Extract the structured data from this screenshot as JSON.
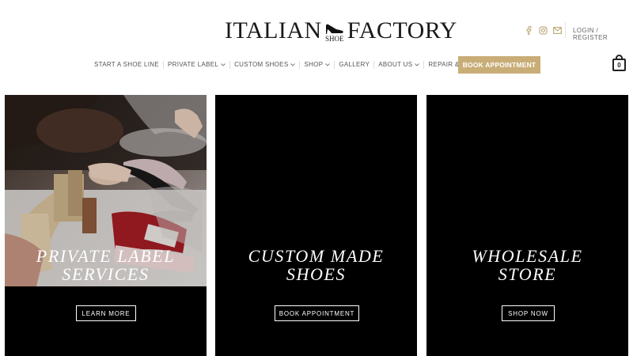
{
  "brand": {
    "word_left": "ITALIAN",
    "word_mid": "SHOE",
    "word_right": "FACTORY"
  },
  "header": {
    "social_icons": [
      "facebook-icon",
      "instagram-icon",
      "mail-icon"
    ],
    "login_label": "LOGIN / REGISTER",
    "cart_count": "0"
  },
  "nav": {
    "items": [
      {
        "label": "START A SHOE LINE",
        "has_dropdown": false
      },
      {
        "label": "PRIVATE LABEL",
        "has_dropdown": true
      },
      {
        "label": "CUSTOM SHOES",
        "has_dropdown": true
      },
      {
        "label": "SHOP",
        "has_dropdown": true
      },
      {
        "label": "GALLERY",
        "has_dropdown": false
      },
      {
        "label": "ABOUT US",
        "has_dropdown": true
      },
      {
        "label": "REPAIR & CARE",
        "has_dropdown": true
      }
    ],
    "cta_label": "BOOK APPOINTMENT"
  },
  "panels": [
    {
      "title_line1": "PRIVATE LABEL",
      "title_line2": "SERVICES",
      "button": "LEARN MORE"
    },
    {
      "title_line1": "CUSTOM MADE",
      "title_line2": "SHOES",
      "button": "BOOK APPOINTMENT"
    },
    {
      "title_line1": "WHOLESALE",
      "title_line2": "STORE",
      "button": "SHOP NOW"
    }
  ],
  "colors": {
    "accent": "#c9ad77",
    "panel_bg": "#000000",
    "text_dark": "#1a1a1a"
  }
}
